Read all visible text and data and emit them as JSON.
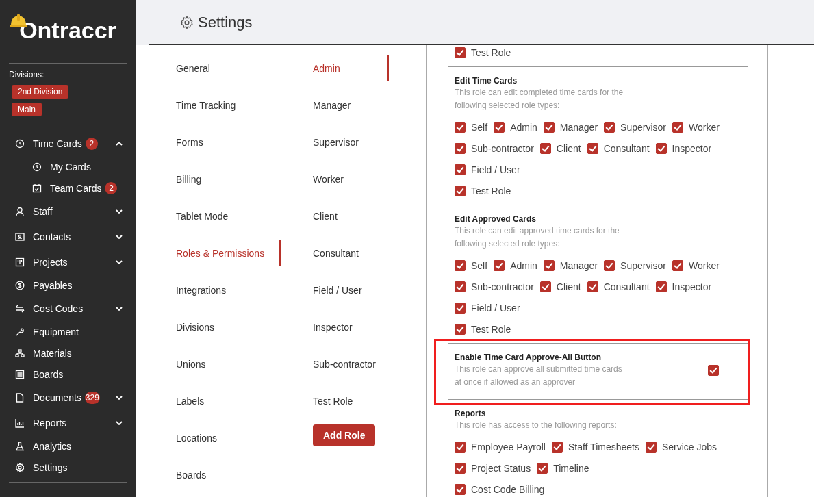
{
  "sidebar": {
    "logo": "Ontraccr",
    "divisions_label": "Divisions:",
    "divisions": [
      "2nd Division",
      "Main"
    ],
    "nav": [
      {
        "label": "Time Cards",
        "badge": "2",
        "expanded": true,
        "children": [
          {
            "label": "My Cards"
          },
          {
            "label": "Team Cards",
            "badge": "2"
          }
        ]
      },
      {
        "label": "Staff",
        "expanded": false
      },
      {
        "label": "Contacts",
        "expanded": false
      },
      {
        "label": "Projects",
        "expanded": false
      },
      {
        "label": "Payables"
      },
      {
        "label": "Cost Codes",
        "expanded": false
      },
      {
        "label": "Equipment"
      },
      {
        "label": "Materials"
      },
      {
        "label": "Boards"
      },
      {
        "label": "Documents",
        "badge": "329",
        "expanded": false
      },
      {
        "label": "Reports",
        "expanded": false
      },
      {
        "label": "Analytics"
      },
      {
        "label": "Settings"
      }
    ]
  },
  "header": {
    "title": "Settings"
  },
  "settings_menu": [
    {
      "label": "General",
      "selected": false
    },
    {
      "label": "Time Tracking",
      "selected": false
    },
    {
      "label": "Forms",
      "selected": false
    },
    {
      "label": "Billing",
      "selected": false
    },
    {
      "label": "Tablet Mode",
      "selected": false
    },
    {
      "label": "Roles & Permissions",
      "selected": true
    },
    {
      "label": "Integrations",
      "selected": false
    },
    {
      "label": "Divisions",
      "selected": false
    },
    {
      "label": "Unions",
      "selected": false
    },
    {
      "label": "Labels",
      "selected": false
    },
    {
      "label": "Locations",
      "selected": false
    },
    {
      "label": "Boards",
      "selected": false
    }
  ],
  "roles": [
    {
      "label": "Admin",
      "selected": true
    },
    {
      "label": "Manager",
      "selected": false
    },
    {
      "label": "Supervisor",
      "selected": false
    },
    {
      "label": "Worker",
      "selected": false
    },
    {
      "label": "Client",
      "selected": false
    },
    {
      "label": "Consultant",
      "selected": false
    },
    {
      "label": "Field / User",
      "selected": false
    },
    {
      "label": "Inspector",
      "selected": false
    },
    {
      "label": "Sub-contractor",
      "selected": false
    },
    {
      "label": "Test Role",
      "selected": false
    }
  ],
  "add_role_button": "Add Role",
  "sections": [
    {
      "kind": "checklist",
      "lines": [
        {
          "options": [
            {
              "label": "Test Role",
              "checked": true
            }
          ]
        }
      ]
    },
    {
      "kind": "checklist",
      "title": "Edit Time Cards",
      "description": [
        "This role can edit completed time cards for the",
        "following selected role types:"
      ],
      "lines": [
        {
          "options": [
            {
              "label": "Self",
              "checked": true
            },
            {
              "label": "Admin",
              "checked": true
            },
            {
              "label": "Manager",
              "checked": true
            },
            {
              "label": "Supervisor",
              "checked": true
            },
            {
              "label": "Worker",
              "checked": true
            }
          ]
        },
        {
          "options": [
            {
              "label": "Sub-contractor",
              "checked": true
            },
            {
              "label": "Client",
              "checked": true
            },
            {
              "label": "Consultant",
              "checked": true
            },
            {
              "label": "Inspector",
              "checked": true
            }
          ]
        },
        {
          "options": [
            {
              "label": "Field / User",
              "checked": true
            }
          ]
        },
        {
          "options": [
            {
              "label": "Test Role",
              "checked": true
            }
          ]
        }
      ]
    },
    {
      "kind": "checklist",
      "title": "Edit Approved Cards",
      "description": [
        "This role can edit approved time cards for the",
        "following selected role types:"
      ],
      "lines": [
        {
          "options": [
            {
              "label": "Self",
              "checked": true
            },
            {
              "label": "Admin",
              "checked": true
            },
            {
              "label": "Manager",
              "checked": true
            },
            {
              "label": "Supervisor",
              "checked": true
            },
            {
              "label": "Worker",
              "checked": true
            }
          ]
        },
        {
          "options": [
            {
              "label": "Sub-contractor",
              "checked": true
            },
            {
              "label": "Client",
              "checked": true
            },
            {
              "label": "Consultant",
              "checked": true
            },
            {
              "label": "Inspector",
              "checked": true
            }
          ]
        },
        {
          "options": [
            {
              "label": "Field / User",
              "checked": true
            }
          ]
        },
        {
          "options": [
            {
              "label": "Test Role",
              "checked": true
            }
          ]
        }
      ]
    },
    {
      "kind": "toggle",
      "title": "Enable Time Card Approve-All Button",
      "description": [
        "This role can approve all submitted time cards",
        "at once if allowed as an approver"
      ],
      "checked": true,
      "highlighted": true
    },
    {
      "kind": "checklist",
      "title": "Reports",
      "description": [
        "This role has access to the following reports:"
      ],
      "lines": [
        {
          "options": [
            {
              "label": "Employee Payroll",
              "checked": true
            },
            {
              "label": "Staff Timesheets",
              "checked": true
            },
            {
              "label": "Service Jobs",
              "checked": true
            }
          ]
        },
        {
          "options": [
            {
              "label": "Project Status",
              "checked": true
            },
            {
              "label": "Timeline",
              "checked": true
            }
          ]
        },
        {
          "options": [
            {
              "label": "Cost Code Billing",
              "checked": true
            }
          ]
        }
      ]
    }
  ]
}
